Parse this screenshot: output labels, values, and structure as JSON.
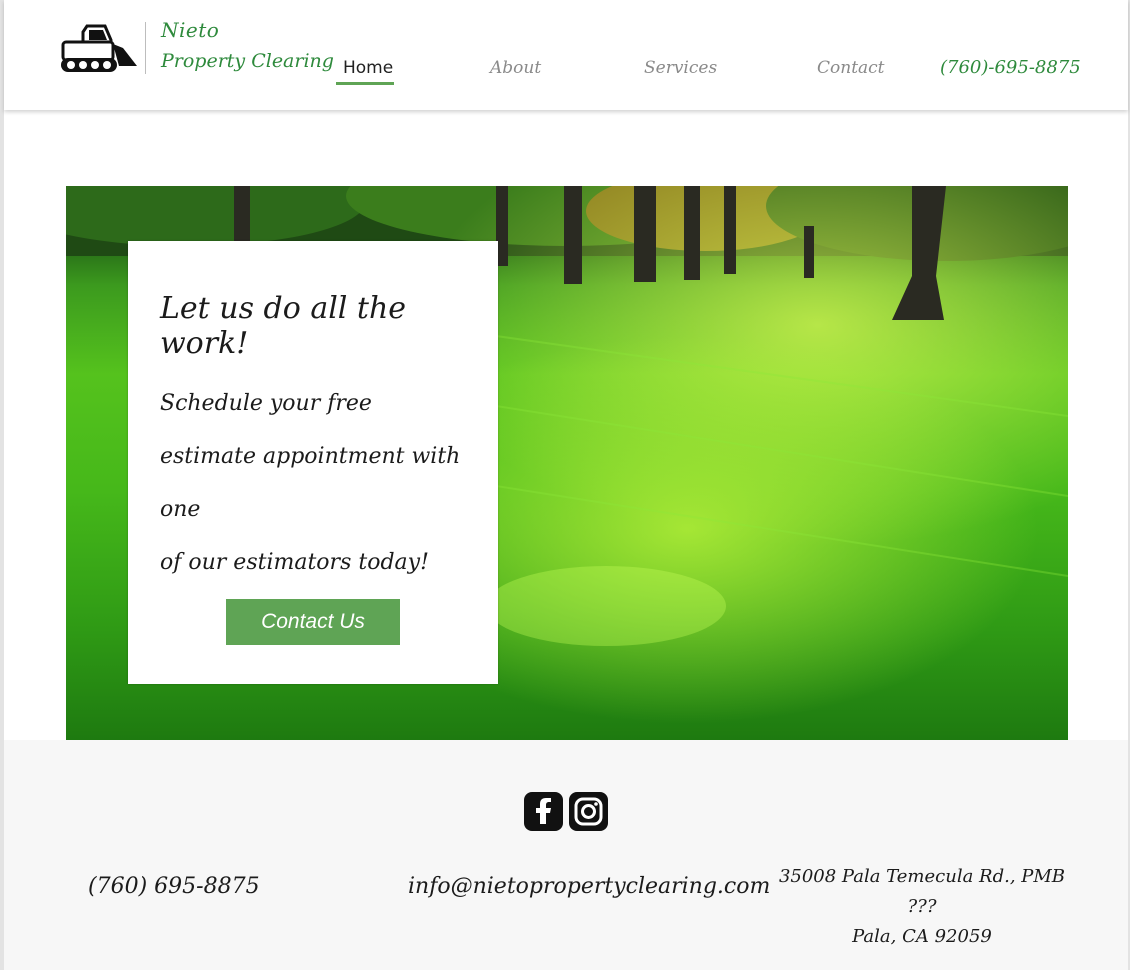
{
  "header": {
    "brand_line1": "Nieto",
    "brand_line2": "Property Clearing",
    "logo_icon": "skid-steer-loader-icon",
    "nav": {
      "home": "Home",
      "about": "About",
      "services": "Services",
      "contact": "Contact",
      "phone": "(760)-695-8875"
    },
    "active_nav": "Home"
  },
  "hero": {
    "heading": "Let us do all the work!",
    "body_line1": "Schedule your free",
    "body_line2": "estimate appointment with one",
    "body_line3": "of our estimators today!",
    "cta_label": "Contact Us"
  },
  "footer": {
    "social_icons": [
      "facebook-icon",
      "instagram-icon"
    ],
    "phone": "(760) 695-8875",
    "email": "info@nietopropertyclearing.com",
    "address_line1": "35008 Pala Temecula Rd., PMB ???",
    "address_line2": "Pala, CA 92059"
  },
  "colors": {
    "accent_green": "#5fa455",
    "brand_green": "#2e8a3c",
    "footer_bg": "#f7f7f7"
  }
}
